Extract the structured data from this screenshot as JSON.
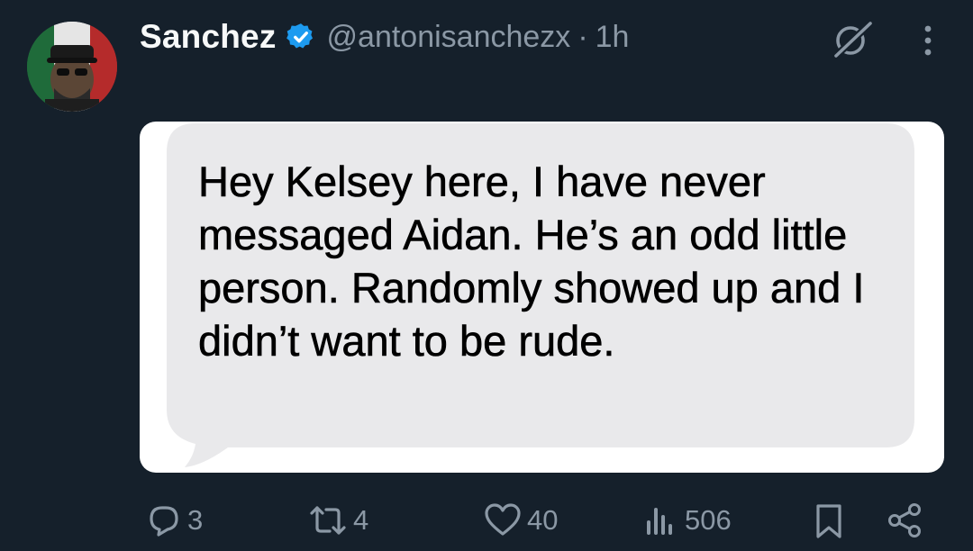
{
  "author": {
    "name": "Sanchez",
    "handle": "@antonisanchezx",
    "separator": "·",
    "time": "1h"
  },
  "message": {
    "text": "Hey Kelsey here, I have never messaged Aidan. He’s an odd little person. Randomly showed up and I didn’t want to be rude."
  },
  "actions": {
    "replies": "3",
    "reposts": "4",
    "likes": "40",
    "views": "506"
  },
  "icons": {
    "verified": "verified-badge-icon",
    "grok": "grok-icon",
    "more": "more-vertical-icon",
    "reply": "reply-icon",
    "repost": "repost-icon",
    "like": "heart-icon",
    "views": "views-chart-icon",
    "bookmark": "bookmark-icon",
    "share": "share-icon"
  },
  "colors": {
    "background": "#15202b",
    "text_primary": "#f7f9f9",
    "text_secondary": "#8b98a5",
    "verified_blue": "#1d9bf0",
    "bubble_gray": "#e9e9eb"
  }
}
